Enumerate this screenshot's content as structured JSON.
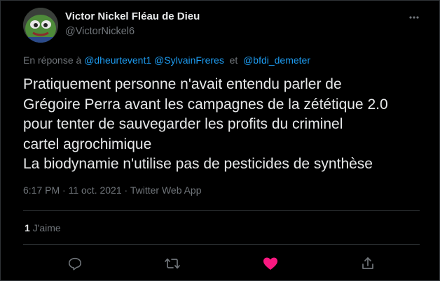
{
  "author": {
    "name": "Victor Nickel Fléau de Dieu",
    "handle": "@VictorNickel6"
  },
  "reply": {
    "prefix": "En réponse à",
    "mention_1": "@dheurtevent1",
    "mention_2": "@SylvainFreres",
    "conjunction": "et",
    "mention_3": "@bfdi_demeter"
  },
  "tweet": {
    "lines": [
      "Pratiquement personne n'avait entendu parler de",
      "Grégoire Perra avant les campagnes de la zététique 2.0",
      "pour tenter de sauvegarder les profits du criminel",
      "cartel agrochimique",
      "La biodynamie n'utilise pas de pesticides de synthèse"
    ]
  },
  "meta": {
    "time": "6:17 PM",
    "date": "11 oct. 2021",
    "source": "Twitter Web App",
    "separator": "·"
  },
  "stats": {
    "likes_count": "1",
    "likes_label": "J'aime"
  },
  "icons": {
    "more": "more-icon",
    "reply": "reply-icon",
    "retweet": "retweet-icon",
    "like": "heart-icon",
    "share": "share-icon"
  },
  "colors": {
    "background": "#000000",
    "text": "#e7e9ea",
    "secondary": "#71767b",
    "link": "#1d9bf0",
    "like": "#f91880",
    "border": "#2f3336"
  }
}
